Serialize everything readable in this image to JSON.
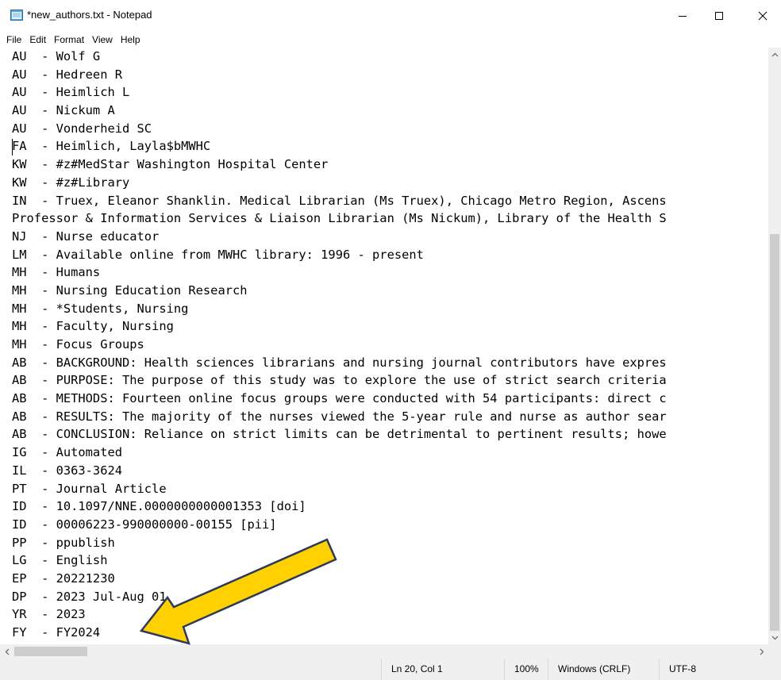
{
  "window": {
    "title": "*new_authors.txt - Notepad",
    "icons": {
      "app": "notepad-icon",
      "minimize": "minimize-icon",
      "maximize": "maximize-icon",
      "close": "close-icon"
    }
  },
  "menu": [
    "File",
    "Edit",
    "Format",
    "View",
    "Help"
  ],
  "editor": {
    "lines": [
      "AU  - Wolf G",
      "AU  - Hedreen R",
      "AU  - Heimlich L",
      "AU  - Nickum A",
      "AU  - Vonderheid SC",
      "FA  - Heimlich, Layla$bMWHC",
      "KW  - #z#MedStar Washington Hospital Center",
      "KW  - #z#Library",
      "IN  - Truex, Eleanor Shanklin. Medical Librarian (Ms Truex), Chicago Metro Region, Ascens",
      "Professor & Information Services & Liaison Librarian (Ms Nickum), Library of the Health S",
      "NJ  - Nurse educator",
      "LM  - Available online from MWHC library: 1996 - present",
      "MH  - Humans",
      "MH  - Nursing Education Research",
      "MH  - *Students, Nursing",
      "MH  - Faculty, Nursing",
      "MH  - Focus Groups",
      "AB  - BACKGROUND: Health sciences librarians and nursing journal contributors have expres",
      "AB  - PURPOSE: The purpose of this study was to explore the use of strict search criteria",
      "AB  - METHODS: Fourteen online focus groups were conducted with 54 participants: direct c",
      "AB  - RESULTS: The majority of the nurses viewed the 5-year rule and nurse as author sear",
      "AB  - CONCLUSION: Reliance on strict limits can be detrimental to pertinent results; howe",
      "IG  - Automated",
      "IL  - 0363-3624",
      "PT  - Journal Article",
      "ID  - 10.1097/NNE.0000000000001353 [doi]",
      "ID  - 00006223-990000000-00155 [pii]",
      "PP  - ppublish",
      "LG  - English",
      "EP  - 20221230",
      "DP  - 2023 Jul-Aug 01",
      "YR  - 2023",
      "FY  - FY2024"
    ]
  },
  "status": {
    "position": "Ln 20, Col 1",
    "zoom": "100%",
    "line_endings": "Windows (CRLF)",
    "encoding": "UTF-8"
  },
  "annotation": {
    "arrow_color": "#FFD100",
    "arrow_outline": "#2E3A59"
  }
}
